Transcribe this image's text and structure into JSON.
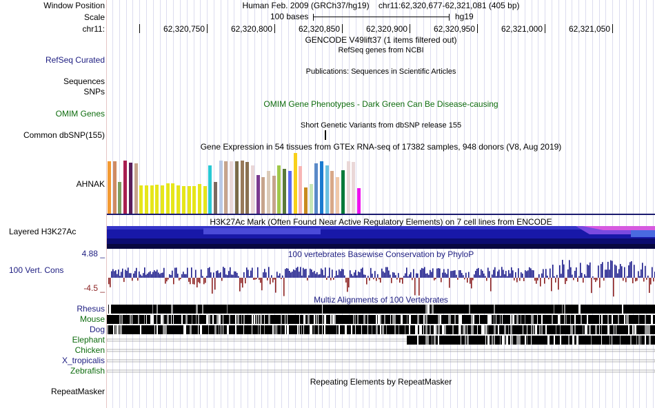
{
  "header": {
    "window_position_label": "Window Position",
    "scale_label": "Scale",
    "chrom_label": "chr11:",
    "assembly": "Human Feb. 2009 (GRCh37/hg19)",
    "position": "chr11:62,320,677-62,321,081 (405 bp)",
    "scale_text": "100 bases",
    "db": "hg19",
    "ruler_ticks": [
      "62,320,750",
      "62,320,800",
      "62,320,850",
      "62,320,900",
      "62,320,950",
      "62,321,000",
      "62,321,050"
    ]
  },
  "tracks": {
    "gencode_title": "GENCODE V49lift37 (1 items filtered out)",
    "refseq_title": "RefSeq genes from NCBI",
    "refseq_label": "RefSeq Curated",
    "publications_title": "Publications: Sequences in Scientific Articles",
    "sequences_label": "Sequences",
    "snps_label": "SNPs",
    "omim_title": "OMIM Gene Phenotypes - Dark Green Can Be Disease-causing",
    "omim_label": "OMIM Genes",
    "dbsnp_title": "Short Genetic Variants from dbSNP release 155",
    "dbsnp_label": "Common dbSNP(155)",
    "gtex_title": "Gene Expression in 54 tissues from GTEx RNA-seq of 17382 samples, 948 donors (V8, Aug 2019)",
    "gtex_gene": "AHNAK",
    "h3k27ac_title": "H3K27Ac Mark (Often Found Near Active Regulatory Elements) on 7 cell lines from ENCODE",
    "h3k27ac_label": "Layered H3K27Ac",
    "cons_title": "100 vertebrates Basewise Conservation by PhyloP",
    "cons_label": "100 Vert. Cons",
    "cons_max": "4.88 _",
    "cons_min": "-4.5 _",
    "multiz_title": "Multiz Alignments of 100 Vertebrates",
    "species": [
      "Rhesus",
      "Mouse",
      "Dog",
      "Elephant",
      "Chicken",
      "X_tropicalis",
      "Zebrafish"
    ],
    "repeat_title": "Repeating Elements by RepeatMasker",
    "repeat_label": "RepeatMasker"
  },
  "colors": {
    "link_blue": "#1c1c80",
    "omim_green": "#0d6b0d",
    "cons_red": "#8b2020",
    "h3k_blue": "#1a18a0"
  },
  "gtex_bars": [
    {
      "h": 0.86,
      "c": "#f39a32"
    },
    {
      "h": 0.86,
      "c": "#cf8b63"
    },
    {
      "h": 0.52,
      "c": "#7e9f61"
    },
    {
      "h": 0.87,
      "c": "#a91e50"
    },
    {
      "h": 0.84,
      "c": "#5a1e5a"
    },
    {
      "h": 0.83,
      "c": "#c6a48c"
    },
    {
      "h": 0.47,
      "c": "#e6e61a"
    },
    {
      "h": 0.47,
      "c": "#e6e61a"
    },
    {
      "h": 0.47,
      "c": "#e6e61a"
    },
    {
      "h": 0.48,
      "c": "#e6e61a"
    },
    {
      "h": 0.47,
      "c": "#e6e61a"
    },
    {
      "h": 0.5,
      "c": "#e6e61a"
    },
    {
      "h": 0.5,
      "c": "#e6e61a"
    },
    {
      "h": 0.47,
      "c": "#e6e61a"
    },
    {
      "h": 0.46,
      "c": "#e6e61a"
    },
    {
      "h": 0.45,
      "c": "#e6e61a"
    },
    {
      "h": 0.45,
      "c": "#e6e61a"
    },
    {
      "h": 0.49,
      "c": "#e6e61a"
    },
    {
      "h": 0.45,
      "c": "#e6e61a"
    },
    {
      "h": 0.8,
      "c": "#28c9d4"
    },
    {
      "h": 0.52,
      "c": "#7a6a60"
    },
    {
      "h": 0.88,
      "c": "#b9c9e6"
    },
    {
      "h": 0.86,
      "c": "#c6a48c"
    },
    {
      "h": 0.86,
      "c": "#ead7d7"
    },
    {
      "h": 0.86,
      "c": "#7a6a48"
    },
    {
      "h": 0.87,
      "c": "#997a5a"
    },
    {
      "h": 0.85,
      "c": "#8a7050"
    },
    {
      "h": 0.8,
      "c": "#ead7d7"
    },
    {
      "h": 0.64,
      "c": "#7a3a90"
    },
    {
      "h": 0.6,
      "c": "#c6a48c"
    },
    {
      "h": 0.7,
      "c": "#dbcab8"
    },
    {
      "h": 0.62,
      "c": "#c6a48c"
    },
    {
      "h": 0.8,
      "c": "#a0c84a"
    },
    {
      "h": 0.74,
      "c": "#5a7a3a"
    },
    {
      "h": 0.7,
      "c": "#5a6aef"
    },
    {
      "h": 1.0,
      "c": "#f8d01a"
    },
    {
      "h": 0.78,
      "c": "#f8b6b6"
    },
    {
      "h": 0.43,
      "c": "#c88a1e"
    },
    {
      "h": 0.49,
      "c": "#c6e6b6"
    },
    {
      "h": 0.83,
      "c": "#5a8ac8"
    },
    {
      "h": 0.86,
      "c": "#1a7ad0"
    },
    {
      "h": 0.8,
      "c": "#6ac0e0"
    },
    {
      "h": 0.7,
      "c": "#d8a888"
    },
    {
      "h": 0.6,
      "c": "#f0c8a8"
    },
    {
      "h": 0.72,
      "c": "#0a7a3a"
    },
    {
      "h": 0.86,
      "c": "#ead7d7"
    },
    {
      "h": 0.85,
      "c": "#ead7d7"
    },
    {
      "h": 0.42,
      "c": "#ee10ee"
    }
  ]
}
